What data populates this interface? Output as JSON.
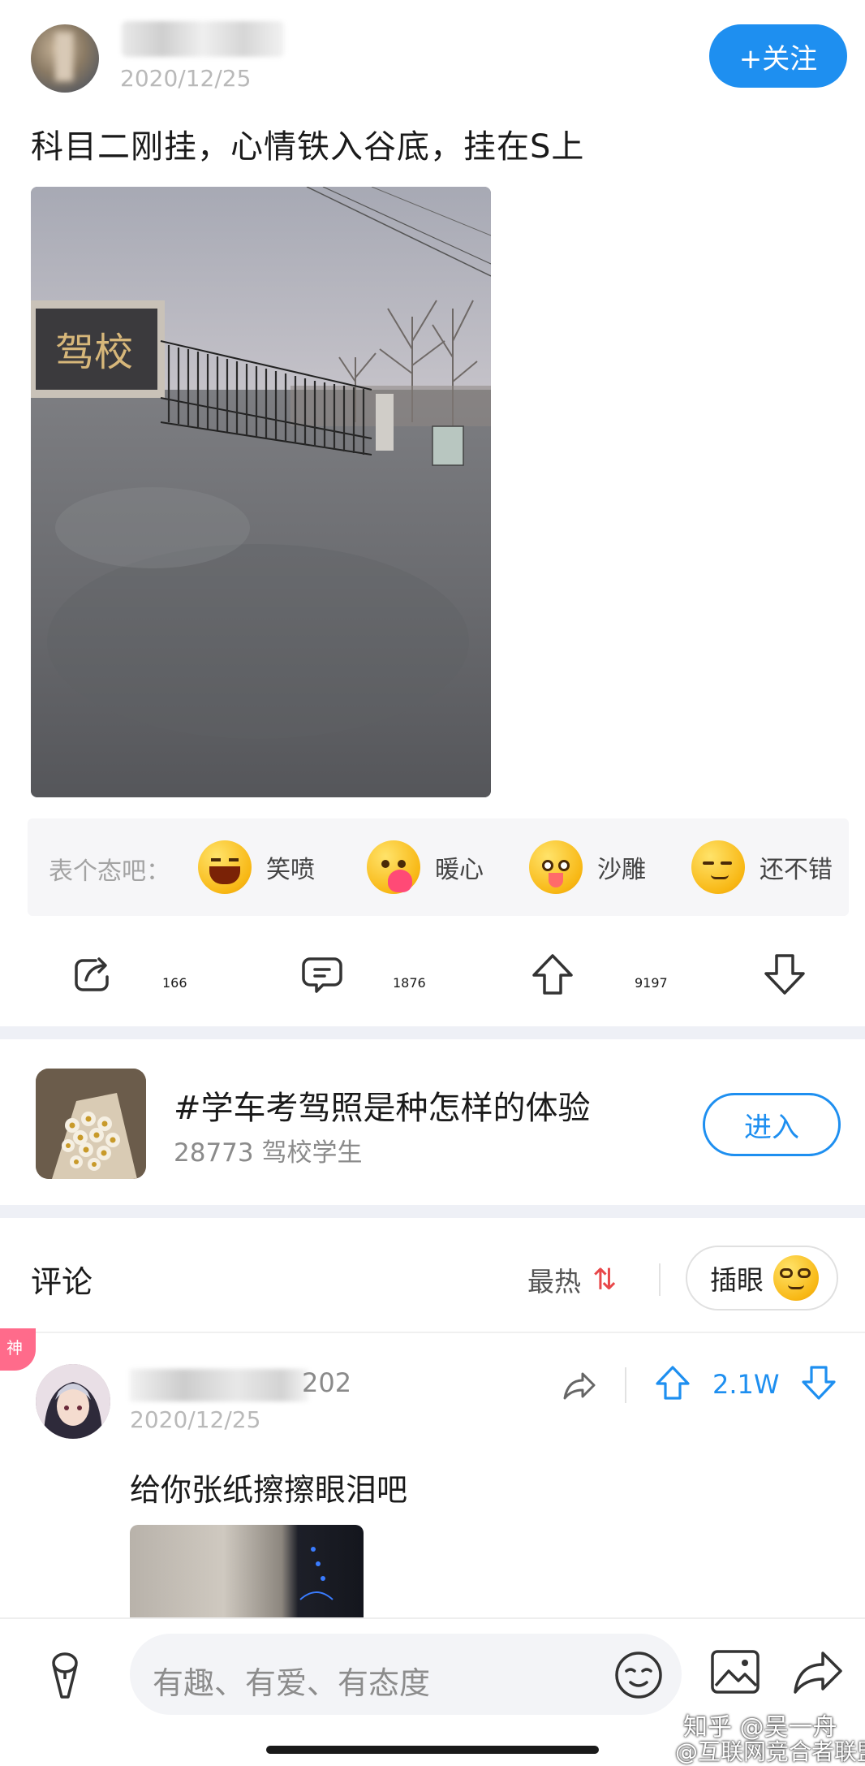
{
  "post": {
    "date": "2020/12/25",
    "follow_label": "+关注",
    "text": "科目二刚挂，心情铁入谷底，挂在S上",
    "image_sign_text": "驾校"
  },
  "reactions": {
    "prompt": "表个态吧：",
    "items": [
      {
        "label": "笑喷",
        "icon": "laughing-tears-emoji-icon"
      },
      {
        "label": "暖心",
        "icon": "hug-heart-emoji-icon"
      },
      {
        "label": "沙雕",
        "icon": "silly-tongue-emoji-icon"
      },
      {
        "label": "还不错",
        "icon": "smirk-emoji-icon"
      }
    ]
  },
  "actions": {
    "share_count": "166",
    "comment_count": "1876",
    "upvote_count": "9197"
  },
  "topic": {
    "title": "#学车考驾照是种怎样的体验",
    "subtitle": "28773 驾校学生",
    "enter_label": "进入"
  },
  "comments": {
    "title": "评论",
    "sort_label": "最热",
    "peek_label": "插眼",
    "items": [
      {
        "badge": "神",
        "name_tail": "202",
        "date": "2020/12/25",
        "votes": "2.1W",
        "text": "给你张纸擦擦眼泪吧"
      }
    ]
  },
  "input": {
    "placeholder": "有趣、有爱、有态度"
  },
  "watermark": {
    "line1": "知乎 @吴一舟",
    "line2": "@互联网竞合者联盟"
  },
  "colors": {
    "accent": "#1e8ff0",
    "hot_sort": "#e8484a",
    "badge": "#ff6b8b"
  }
}
